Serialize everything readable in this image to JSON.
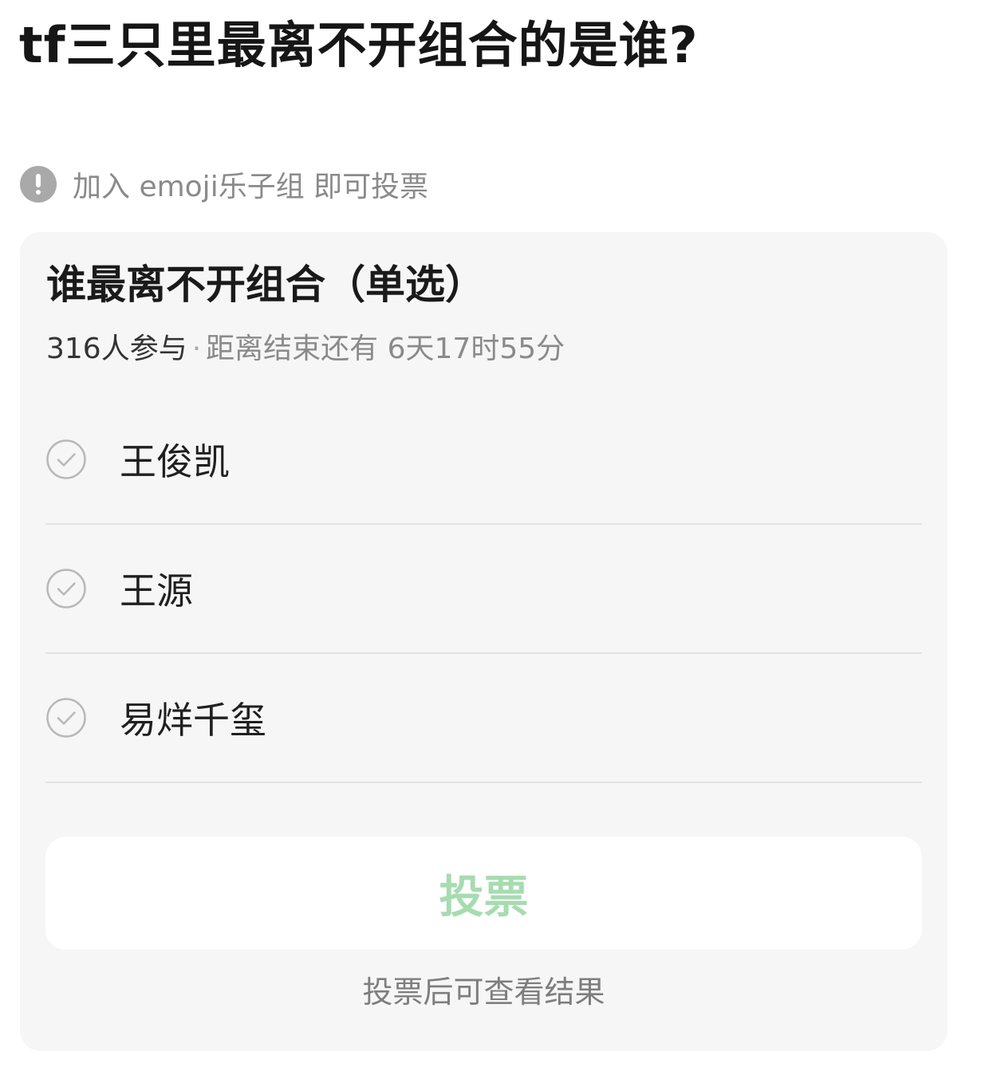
{
  "post": {
    "title": "tf三只里最离不开组合的是谁?"
  },
  "notice": {
    "icon": "exclamation-circle-icon",
    "text": "加入 emoji乐子组 即可投票"
  },
  "poll": {
    "title": "谁最离不开组合（单选）",
    "participants": "316人参与",
    "separator": "·",
    "deadline": "距离结束还有 6天17时55分",
    "options": [
      {
        "label": "王俊凯",
        "icon": "check-circle-icon"
      },
      {
        "label": "王源",
        "icon": "check-circle-icon"
      },
      {
        "label": "易烊千玺",
        "icon": "check-circle-icon"
      }
    ],
    "vote_button": "投票",
    "vote_hint": "投票后可查看结果"
  },
  "colors": {
    "vote_button_text": "#a6dcb0",
    "card_background": "#f6f6f6",
    "notice_icon": "#a9a9a9"
  }
}
